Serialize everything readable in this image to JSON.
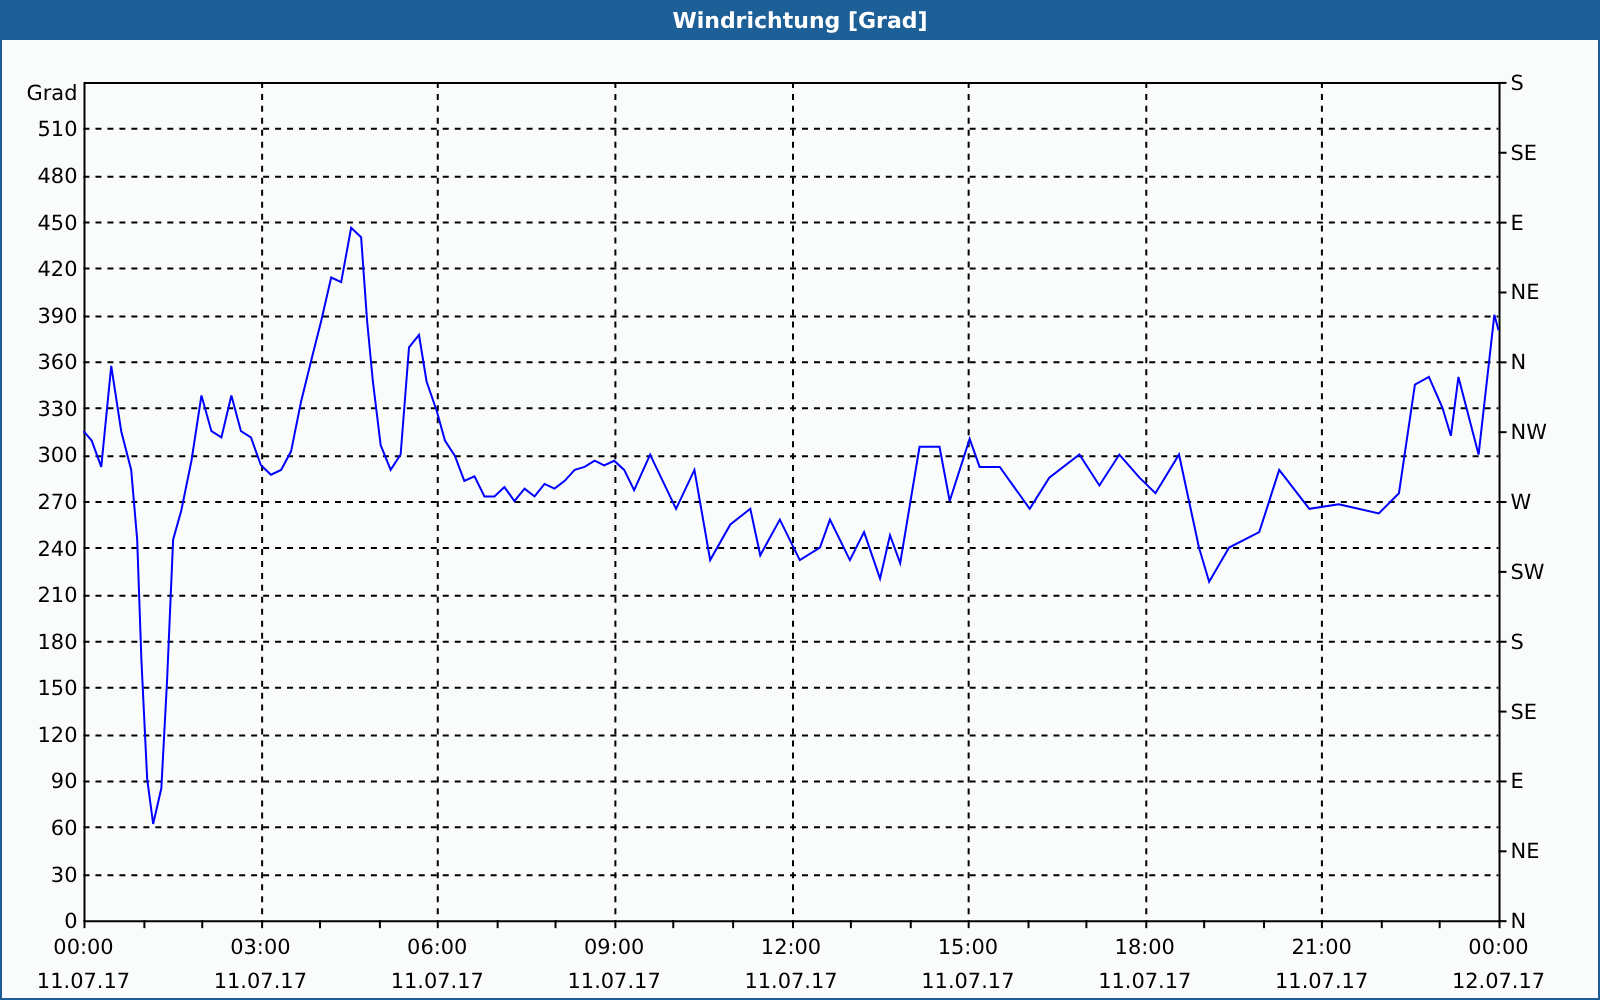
{
  "window": {
    "title": "Windrichtung [Grad]"
  },
  "chart": {
    "chart_data": {
      "type": "line",
      "ylabel": "Grad",
      "grid": true,
      "xlim": [
        0,
        24
      ],
      "ylim": [
        0,
        540
      ],
      "yticks": [
        0,
        30,
        60,
        90,
        120,
        150,
        180,
        210,
        240,
        270,
        300,
        330,
        360,
        390,
        420,
        450,
        480,
        510
      ],
      "xticks": [
        {
          "value": 0,
          "label": "00:00"
        },
        {
          "value": 3,
          "label": "03:00"
        },
        {
          "value": 6,
          "label": "06:00"
        },
        {
          "value": 9,
          "label": "09:00"
        },
        {
          "value": 12,
          "label": "12:00"
        },
        {
          "value": 15,
          "label": "15:00"
        },
        {
          "value": 18,
          "label": "18:00"
        },
        {
          "value": 21,
          "label": "21:00"
        },
        {
          "value": 24,
          "label": "00:00"
        }
      ],
      "x": [
        0,
        0.14,
        0.3,
        0.47,
        0.64,
        0.81,
        0.91,
        0.98,
        1.08,
        1.18,
        1.32,
        1.42,
        1.52,
        1.66,
        1.83,
        2.0,
        2.17,
        2.34,
        2.51,
        2.67,
        2.84,
        3.01,
        3.18,
        3.35,
        3.52,
        3.69,
        3.86,
        4.03,
        4.2,
        4.37,
        4.54,
        4.71,
        4.81,
        4.91,
        5.04,
        5.21,
        5.38,
        5.52,
        5.69,
        5.82,
        5.99,
        6.13,
        6.3,
        6.46,
        6.63,
        6.8,
        6.97,
        7.14,
        7.31,
        7.48,
        7.65,
        7.82,
        7.99,
        8.16,
        8.33,
        8.5,
        8.67,
        8.83,
        9.0,
        9.17,
        9.34,
        9.61,
        10.05,
        10.36,
        10.63,
        10.97,
        11.31,
        11.48,
        11.81,
        12.15,
        12.49,
        12.66,
        13.0,
        13.24,
        13.51,
        13.68,
        13.85,
        14.18,
        14.52,
        14.69,
        15.03,
        15.2,
        15.54,
        16.05,
        16.38,
        16.89,
        17.23,
        17.57,
        17.91,
        18.18,
        18.58,
        18.92,
        19.09,
        19.43,
        19.94,
        20.28,
        20.79,
        21.29,
        21.97,
        22.31,
        22.58,
        22.82,
        23.05,
        23.19,
        23.32,
        23.66,
        23.93,
        24.0
      ],
      "series": [
        {
          "color": "#0000ff",
          "values": [
            315,
            309,
            292,
            357,
            315,
            290,
            245,
            168,
            91,
            62,
            85,
            155,
            245,
            264,
            296,
            338,
            315,
            311,
            338,
            315,
            311,
            293,
            287,
            290,
            302,
            334,
            360,
            386,
            414,
            411,
            446,
            440,
            386,
            347,
            306,
            290,
            300,
            369,
            377,
            347,
            328,
            309,
            299,
            283,
            286,
            273,
            273,
            279,
            270,
            278,
            273,
            281,
            278,
            283,
            290,
            292,
            296,
            293,
            296,
            290,
            277,
            300,
            265,
            290,
            232,
            255,
            265,
            235,
            258,
            232,
            240,
            258,
            232,
            250,
            220,
            248,
            230,
            305,
            305,
            270,
            310,
            292,
            292,
            265,
            285,
            300,
            280,
            300,
            285,
            275,
            300,
            240,
            218,
            240,
            250,
            290,
            265,
            268,
            262,
            275,
            345,
            350,
            330,
            312,
            350,
            300,
            390,
            380
          ]
        }
      ]
    },
    "x_dates": [
      "11.07.17",
      "11.07.17",
      "11.07.17",
      "11.07.17",
      "11.07.17",
      "11.07.17",
      "11.07.17",
      "11.07.17",
      "12.07.17"
    ],
    "compass_labels": [
      "S",
      "SE",
      "E",
      "NE",
      "N",
      "NW",
      "W",
      "SW",
      "S",
      "SE",
      "E",
      "NE",
      "N"
    ]
  }
}
